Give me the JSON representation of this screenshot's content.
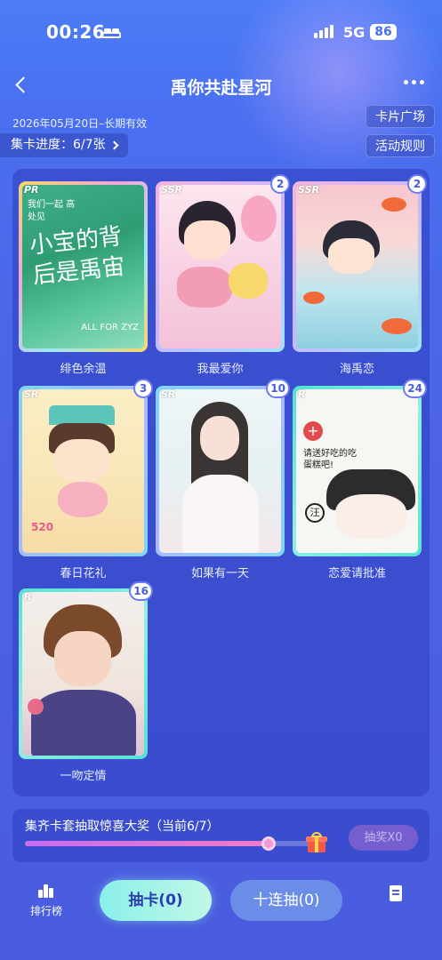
{
  "status_bar": {
    "time": "00:26",
    "network": "5G",
    "battery": "86"
  },
  "header": {
    "title": "禹你共赴星河"
  },
  "info": {
    "validity": "2026年05月20日–长期有效",
    "progress": "集卡进度：6/7张",
    "card_square": "卡片广场",
    "rules": "活动规则"
  },
  "cards": [
    {
      "rarity": "PR",
      "name": "绯色余温",
      "count": "",
      "art_text": "小宝的背后是禹宙",
      "art_sub": "我们一起 高处见",
      "art_tag": "ALL FOR ZYZ"
    },
    {
      "rarity": "SSR",
      "name": "我最爱你",
      "count": "2"
    },
    {
      "rarity": "SSR",
      "name": "海禹恋",
      "count": "2"
    },
    {
      "rarity": "SR",
      "name": "春日花礼",
      "count": "3",
      "art_tag": "520"
    },
    {
      "rarity": "SR",
      "name": "如果有一天",
      "count": "10"
    },
    {
      "rarity": "R",
      "name": "恋爱请批准",
      "count": "24",
      "art_text": "请送好吃的吃蛋糕吧!",
      "art_tag": "汪"
    },
    {
      "rarity": "R",
      "name": "一吻定情",
      "count": "16"
    }
  ],
  "reward": {
    "text": "集齐卡套抽取惊喜大奖（当前6/7）",
    "progress": 0.857,
    "draw_button": "抽奖X0"
  },
  "bottom_nav": {
    "rank_label": "排行榜",
    "draw_button": "抽卡(0)",
    "draw10_button": "十连抽(0)"
  }
}
